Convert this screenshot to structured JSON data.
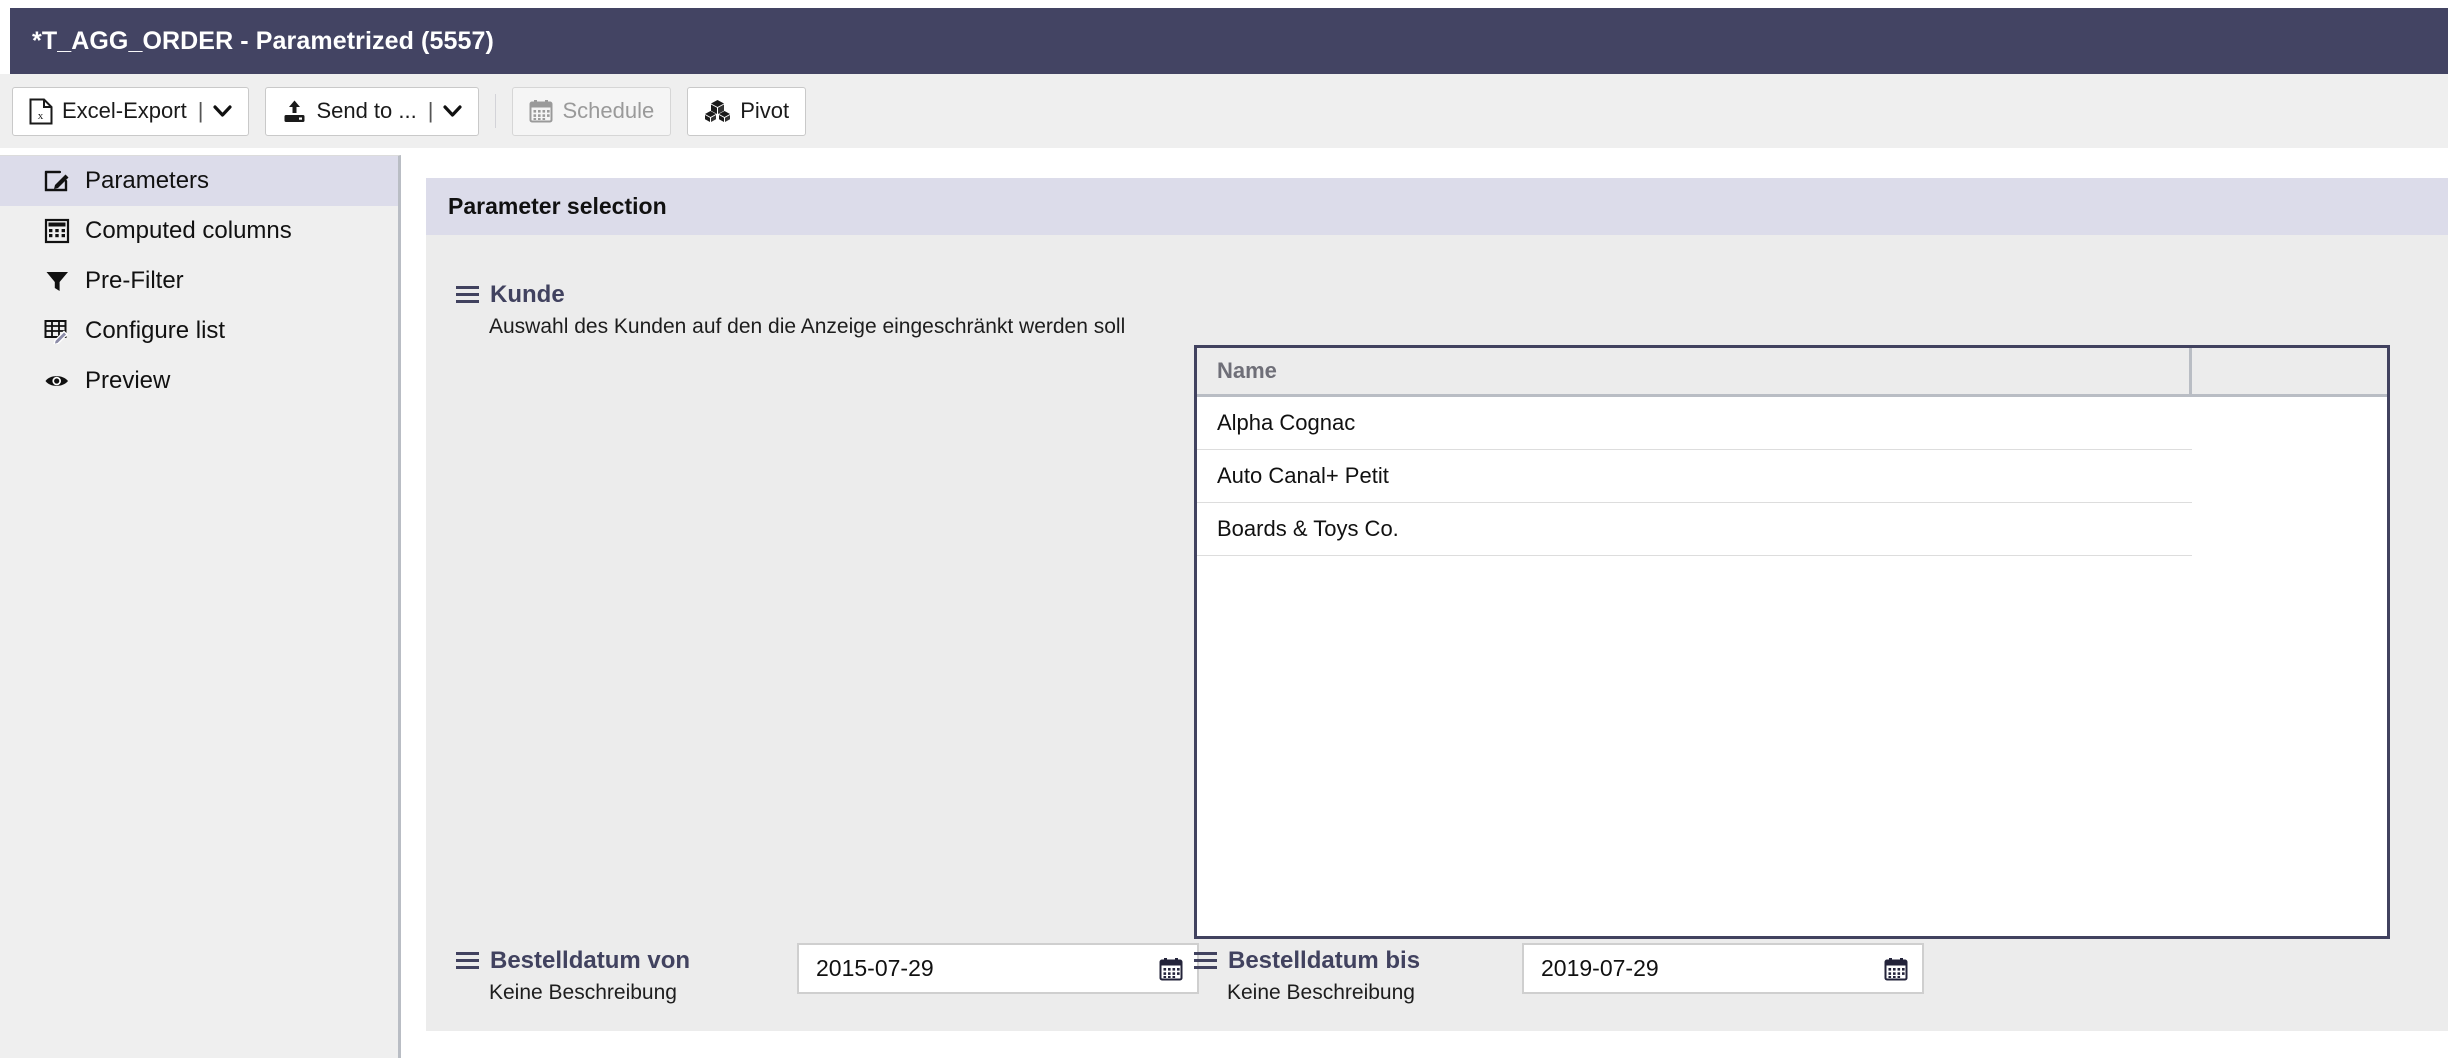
{
  "window": {
    "title": "*T_AGG_ORDER - Parametrized (5557)",
    "titlebar_color": "#434463"
  },
  "toolbar": {
    "buttons": [
      {
        "label": "Excel-Export",
        "icon": "excel-file-icon",
        "has_dropdown": true,
        "disabled": false
      },
      {
        "label": "Send to ...",
        "icon": "upload-icon",
        "has_dropdown": true,
        "disabled": false
      },
      {
        "label": "Schedule",
        "icon": "calendar-icon",
        "has_dropdown": false,
        "disabled": true
      },
      {
        "label": "Pivot",
        "icon": "pivot-cubes-icon",
        "has_dropdown": false,
        "disabled": false
      }
    ],
    "divider": "|",
    "caret": "❯"
  },
  "sidebar": {
    "items": [
      {
        "label": "Parameters",
        "icon": "edit-document-icon",
        "active": true
      },
      {
        "label": "Computed columns",
        "icon": "calculator-icon",
        "active": false
      },
      {
        "label": "Pre-Filter",
        "icon": "funnel-icon",
        "active": false
      },
      {
        "label": "Configure list",
        "icon": "table-edit-icon",
        "active": false
      },
      {
        "label": "Preview",
        "icon": "eye-icon",
        "active": false
      }
    ],
    "active_background": "#dcdcea"
  },
  "main": {
    "panel_title": "Parameter selection",
    "panel_header_color": "#dcdcea",
    "kunde_param": {
      "title": "Kunde",
      "description": "Auswahl des Kunden auf den die Anzeige eingeschränkt werden soll",
      "drag_handle_icon": "hamburger-handle-icon"
    },
    "table": {
      "columns": [
        "Name",
        ""
      ],
      "rows": [
        {
          "name": "Alpha Cognac"
        },
        {
          "name": "Auto Canal+ Petit"
        },
        {
          "name": "Boards & Toys Co."
        }
      ],
      "border_color": "#41425f"
    },
    "date_params": [
      {
        "title": "Bestelldatum von",
        "description": "Keine Beschreibung",
        "value": "2015-07-29",
        "placeholder": "YYYY-MM-DD",
        "calendar_icon": "calendar-icon",
        "drag_handle_icon": "hamburger-handle-icon"
      },
      {
        "title": "Bestelldatum bis",
        "description": "Keine Beschreibung",
        "value": "2019-07-29",
        "placeholder": "YYYY-MM-DD",
        "calendar_icon": "calendar-icon",
        "drag_handle_icon": "hamburger-handle-icon"
      }
    ]
  }
}
